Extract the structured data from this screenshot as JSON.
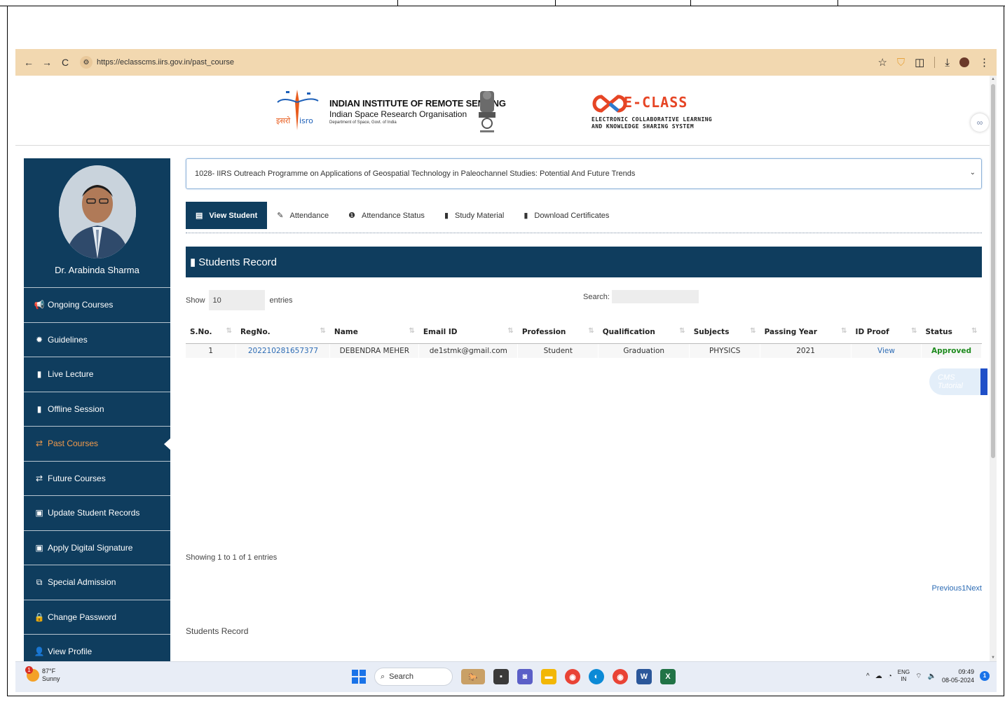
{
  "browser": {
    "url": "https://eclasscms.iirs.gov.in/past_course",
    "nav": {
      "back": "←",
      "forward": "→",
      "reload": "C"
    }
  },
  "header": {
    "org_title": "INDIAN INSTITUTE OF REMOTE SENSING",
    "org_subtitle": "Indian Space Research Organisation",
    "org_dept": "Department of Space, Govt. of India",
    "isro_hindi": "इसरो",
    "isro_latin": "isro",
    "eclass_title": "E-CLASS",
    "eclass_sub_line1": "ELECTRONIC COLLABORATIVE LEARNING",
    "eclass_sub_line2": "AND KNOWLEDGE SHARING SYSTEM"
  },
  "sidebar": {
    "profile_name": "Dr. Arabinda Sharma",
    "items": [
      {
        "label": "Ongoing Courses",
        "icon": "megaphone-icon",
        "glyph": "📢"
      },
      {
        "label": "Guidelines",
        "icon": "badge-icon",
        "glyph": "✹"
      },
      {
        "label": "Live Lecture",
        "icon": "book-icon",
        "glyph": "▮"
      },
      {
        "label": "Offline Session",
        "icon": "book-icon",
        "glyph": "▮"
      },
      {
        "label": "Past Courses",
        "icon": "exchange-icon",
        "glyph": "⇄",
        "active": true
      },
      {
        "label": "Future Courses",
        "icon": "exchange-icon",
        "glyph": "⇄"
      },
      {
        "label": "Update Student Records",
        "icon": "file-icon",
        "glyph": "▣"
      },
      {
        "label": "Apply Digital Signature",
        "icon": "file-icon",
        "glyph": "▣"
      },
      {
        "label": "Special Admission",
        "icon": "external-link-icon",
        "glyph": "⧉"
      },
      {
        "label": "Change Password",
        "icon": "lock-icon",
        "glyph": "🔒"
      },
      {
        "label": "View Profile",
        "icon": "user-icon",
        "glyph": "👤"
      }
    ]
  },
  "main": {
    "course_selected": "1028- IIRS Outreach Programme on Applications of Geospatial Technology in Paleochannel Studies: Potential And Future Trends",
    "tabs": [
      {
        "label": "View Student",
        "glyph": "▤",
        "active": true
      },
      {
        "label": "Attendance",
        "glyph": "✎"
      },
      {
        "label": "Attendance Status",
        "glyph": "❶"
      },
      {
        "label": "Study Material",
        "glyph": "▮"
      },
      {
        "label": "Download Certificates",
        "glyph": "▮"
      }
    ],
    "section_title": "Students Record",
    "show_label": "Show",
    "show_value": "10",
    "entries_label": "entries",
    "search_label": "Search:",
    "columns": [
      "S.No.",
      "RegNo.",
      "Name",
      "Email ID",
      "Profession",
      "Qualification",
      "Subjects",
      "Passing Year",
      "ID Proof",
      "Status"
    ],
    "rows": [
      {
        "sno": "1",
        "regno": "202210281657377",
        "name": "DEBENDRA MEHER",
        "email": "de1stmk@gmail.com",
        "profession": "Student",
        "qualification": "Graduation",
        "subjects": "PHYSICS",
        "passing_year": "2021",
        "id_proof": "View",
        "status": "Approved"
      }
    ],
    "showing_text": "Showing 1 to 1 of 1 entries",
    "pager": {
      "previous": "Previous",
      "page": "1",
      "next": "Next"
    },
    "footer_caption": "Students Record",
    "cms_tutorial": "CMS Tutorial"
  },
  "taskbar": {
    "weather_temp": "87°F",
    "weather_cond": "Sunny",
    "weather_badge": "1",
    "search_placeholder": "Search",
    "lang_line1": "ENG",
    "lang_line2": "IN",
    "time": "09:49",
    "date": "08-05-2024",
    "notif_count": "1"
  },
  "colors": {
    "sidebar_bg": "#0f3d5e",
    "active_menu": "#f39b4b",
    "chrome_bar": "#f2d8b0",
    "approved": "#1e8b1e",
    "link": "#2d6cb5",
    "eclass_red": "#e64525"
  }
}
